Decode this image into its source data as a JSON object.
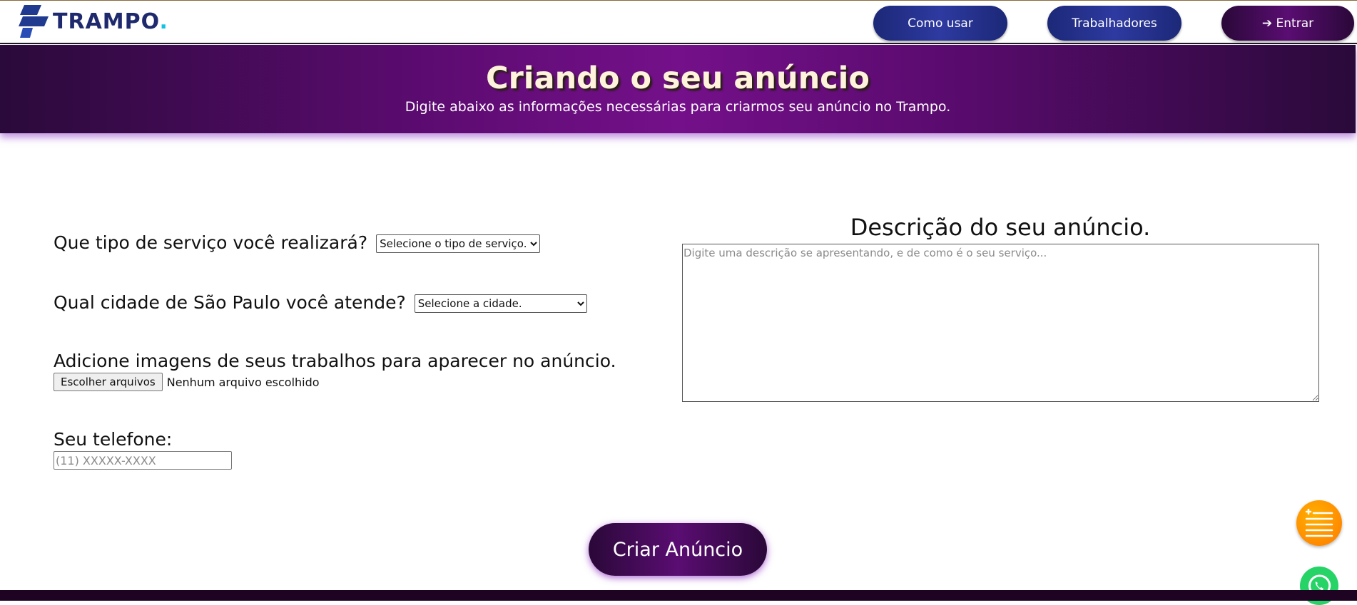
{
  "brand": {
    "name": "TRAMPO",
    "dot": "."
  },
  "nav": {
    "como_usar": "Como usar",
    "trabalhadores": "Trabalhadores",
    "entrar": "➔ Entrar"
  },
  "hero": {
    "title": "Criando o seu anúncio",
    "subtitle": "Digite abaixo as informações necessárias para criarmos seu anúncio no Trampo."
  },
  "form": {
    "service_label": "Que tipo de serviço você realizará?",
    "service_selected": "Selecione o tipo de serviço.",
    "city_label": "Qual cidade de São Paulo você atende?",
    "city_selected": "Selecione a cidade.",
    "images_label": "Adicione imagens de seus trabalhos para aparecer no anúncio.",
    "file_button": "Escolher arquivos",
    "file_status": "Nenhum arquivo escolhido",
    "phone_label": "Seu telefone:",
    "phone_placeholder": "(11) XXXXX-XXXX",
    "description_title": "Descrição do seu anúncio.",
    "description_placeholder": "Digite uma descrição se apresentando, e de como é o seu serviço...",
    "submit_label": "Criar Anúncio"
  },
  "icons": {
    "logo": "trampo-logo-icon",
    "menu_fab": "menu-list-icon",
    "whatsapp": "whatsapp-icon"
  },
  "colors": {
    "brand_blue": "#1f2a6e",
    "brand_dot": "#12c2e3",
    "purple_dark": "#2a0838",
    "purple_mid": "#74108a",
    "fab_orange": "#ff8c00",
    "whatsapp_green": "#25d366"
  }
}
